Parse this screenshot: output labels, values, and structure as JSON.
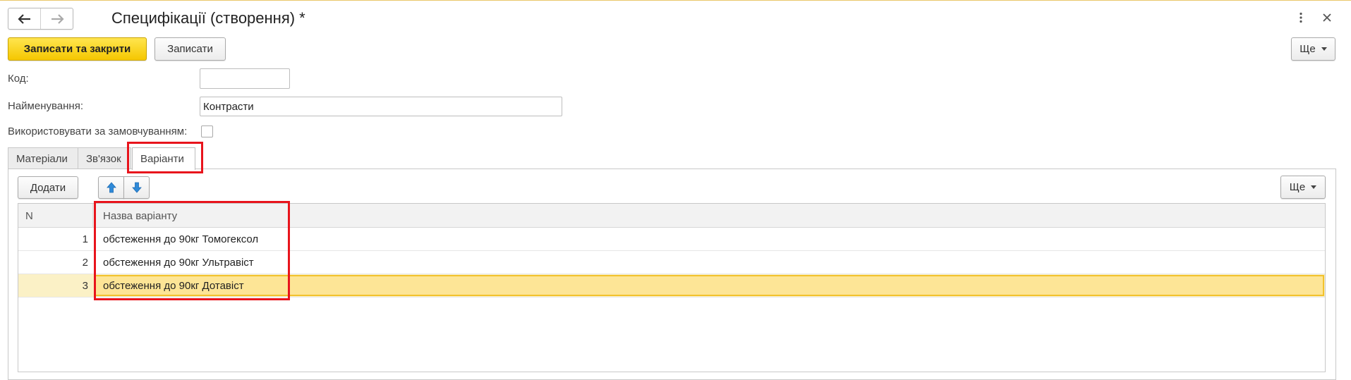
{
  "window": {
    "title": "Специфікації (створення) *",
    "icons": {
      "back": "arrow-left-icon",
      "forward": "arrow-right-icon",
      "menu": "vertical-dots-icon",
      "close": "close-icon"
    }
  },
  "toolbar": {
    "save_close_label": "Записати та закрити",
    "save_label": "Записати",
    "more_label": "Ще"
  },
  "form": {
    "code_label": "Код:",
    "code_value": "",
    "name_label": "Найменування:",
    "name_value": "Контрасти",
    "default_label": "Використовувати за замовчуванням:",
    "default_checked": false
  },
  "tabs": [
    {
      "label": "Матеріали",
      "active": false
    },
    {
      "label": "Зв'язок",
      "active": false
    },
    {
      "label": "Варіанти",
      "active": true
    }
  ],
  "variants_panel": {
    "add_label": "Додати",
    "more_label": "Ще",
    "icons": {
      "move_up": "arrow-up-icon",
      "move_down": "arrow-down-icon"
    },
    "columns": [
      "N",
      "Назва варіанту"
    ],
    "rows": [
      {
        "n": "1",
        "name": "обстеження до 90кг Томогексол"
      },
      {
        "n": "2",
        "name": "обстеження до 90кг Ультравіст"
      },
      {
        "n": "3",
        "name": "обстеження до 90кг Дотавіст"
      }
    ],
    "selected_row": 3
  },
  "colors": {
    "primary_button": "#f5c700",
    "highlight": "#e8141c",
    "selected_row": "#fde596"
  }
}
